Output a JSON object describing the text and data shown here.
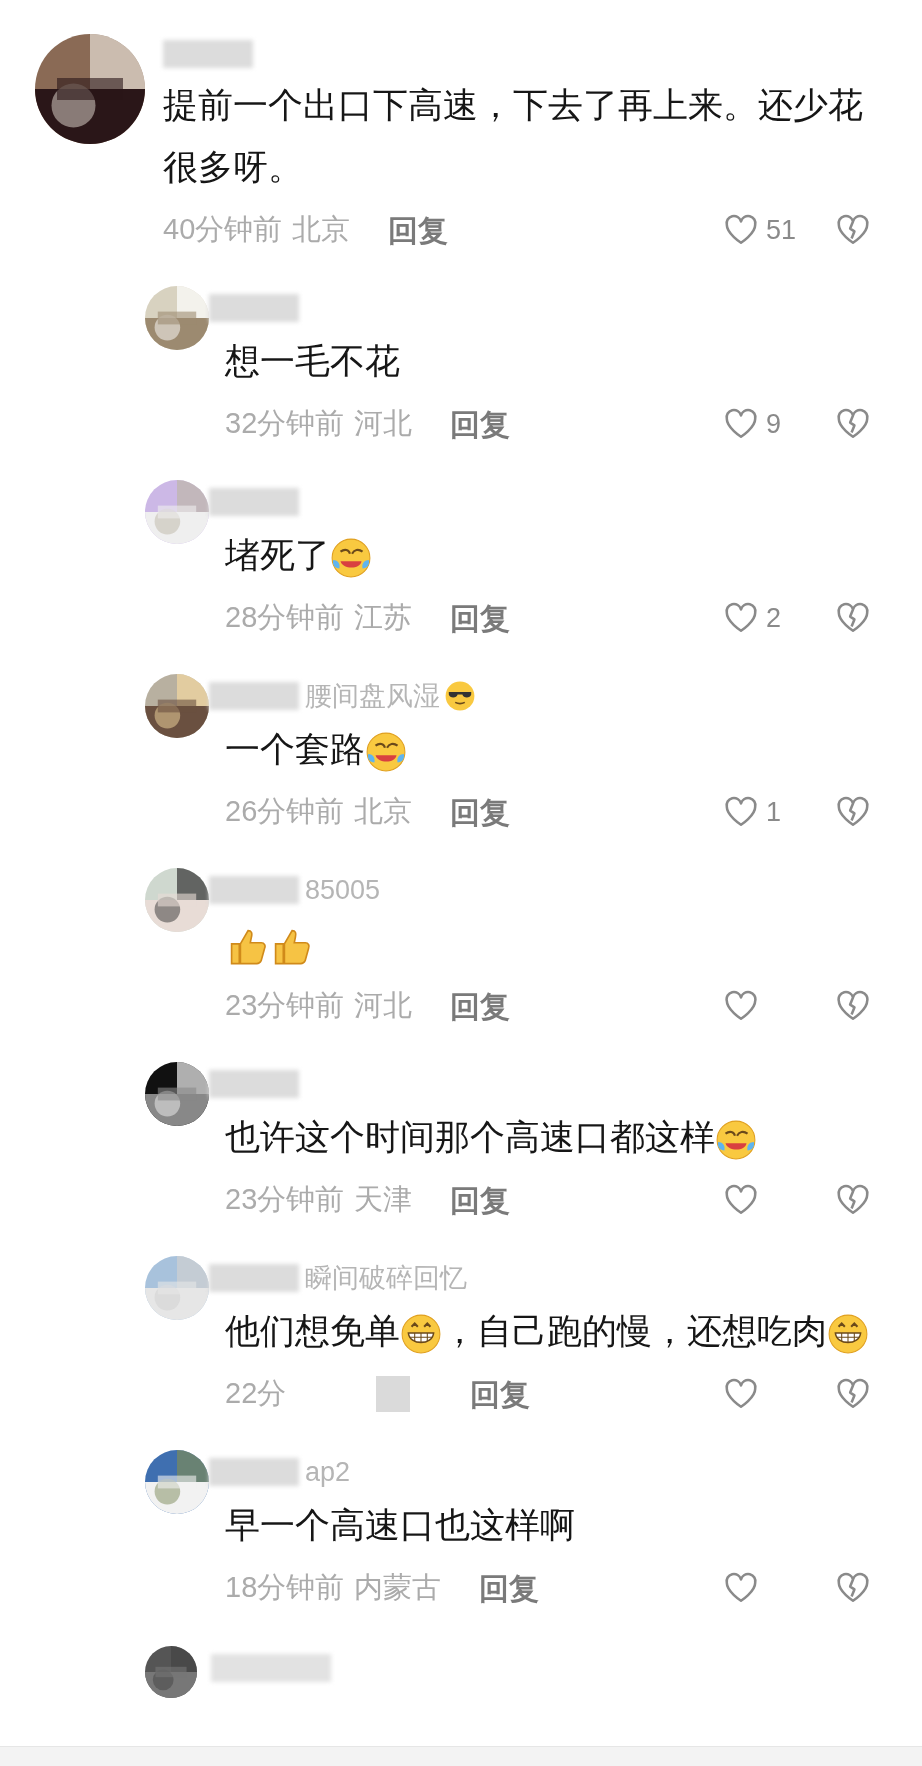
{
  "comments": [
    {
      "kind": "comment",
      "body": [
        {
          "kind": "text",
          "text": "提前一个出口下高速，下去了再上来。还少花很多呀。"
        }
      ],
      "time": "40分钟前",
      "location": "北京",
      "reply": "回复",
      "likes": "51"
    },
    {
      "kind": "reply",
      "body": [
        {
          "kind": "text",
          "text": "想一毛不花"
        }
      ],
      "time": "32分钟前",
      "location": "河北",
      "reply": "回复",
      "likes": "9"
    },
    {
      "kind": "reply",
      "body": [
        {
          "kind": "text",
          "text": "堵死了"
        },
        {
          "kind": "laugh-cry"
        }
      ],
      "time": "28分钟前",
      "location": "江苏",
      "reply": "回复",
      "likes": "2"
    },
    {
      "kind": "reply",
      "name_text": "腰间盘风湿",
      "name_emoji": {
        "kind": "sunglasses"
      },
      "body": [
        {
          "kind": "text",
          "text": "一个套路"
        },
        {
          "kind": "laugh-cry"
        }
      ],
      "time": "26分钟前",
      "location": "北京",
      "reply": "回复",
      "likes": "1"
    },
    {
      "kind": "reply",
      "name_text": "85005",
      "body": [
        {
          "kind": "thumbs-up"
        },
        {
          "kind": "thumbs-up"
        }
      ],
      "time": "23分钟前",
      "location": "河北",
      "reply": "回复"
    },
    {
      "kind": "reply",
      "body": [
        {
          "kind": "text",
          "text": "也许这个时间那个高速口都这样"
        },
        {
          "kind": "laugh-cry"
        }
      ],
      "time": "23分钟前",
      "location": "天津",
      "reply": "回复"
    },
    {
      "kind": "reply",
      "name_text": "瞬间破碎回忆",
      "body": [
        {
          "kind": "text",
          "text": "他们想免单"
        },
        {
          "kind": "grin"
        },
        {
          "kind": "text",
          "text": "，自己跑的慢，还想吃"
        },
        {
          "kind": "text",
          "text": "肉"
        },
        {
          "kind": "grin"
        }
      ],
      "time": "22分",
      "reply": "回复",
      "time_covered": true
    },
    {
      "kind": "reply",
      "name_text": "ap2",
      "body": [
        {
          "kind": "text",
          "text": "早一个高速口也这样啊"
        }
      ],
      "time": "18分钟前",
      "location": "内蒙古",
      "reply": "回复"
    },
    {
      "kind": "reply",
      "cut": true
    }
  ]
}
